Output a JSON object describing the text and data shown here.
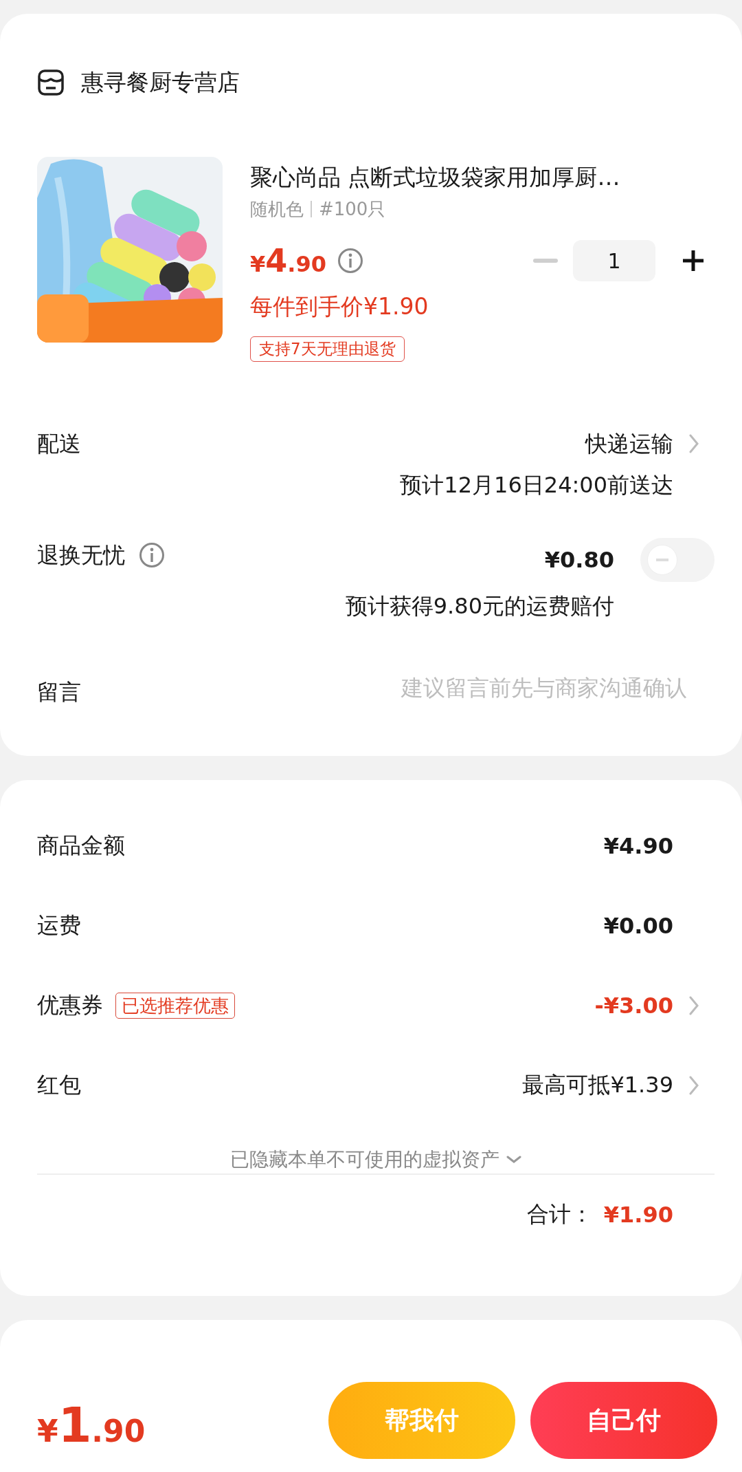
{
  "store": {
    "name": "惠寻餐厨专营店"
  },
  "product": {
    "title": "聚心尚品 点断式垃圾袋家用加厚厨…",
    "spec_color": "随机色",
    "spec_size": "#100只",
    "price_symbol": "¥",
    "price_int": "4",
    "price_dec": ".90",
    "final_price": "每件到手价¥1.90",
    "return_tag": "支持7天无理由退货",
    "quantity": "1",
    "decrease_disabled": true
  },
  "delivery": {
    "label": "配送",
    "method": "快递运输",
    "eta": "预计12月16日24:00前送达"
  },
  "return_insurance": {
    "label": "退换无忧",
    "price": "¥0.80",
    "on": false,
    "note": "预计获得9.80元的运费赔付"
  },
  "message": {
    "label": "留言",
    "placeholder": "建议留言前先与商家沟通确认"
  },
  "summary": {
    "rows": [
      {
        "label": "商品金额",
        "value": "¥4.90",
        "kind": "plain"
      },
      {
        "label": "运费",
        "value": "¥0.00",
        "kind": "plain"
      },
      {
        "label": "优惠券",
        "tag": "已选推荐优惠",
        "value": "-¥3.00",
        "kind": "discount"
      },
      {
        "label": "红包",
        "value": "最高可抵¥1.39",
        "kind": "link"
      }
    ],
    "hidden_note": "已隐藏本单不可使用的虚拟资产",
    "total_label": "合计：",
    "total": "¥1.90"
  },
  "bottom_bar": {
    "price_symbol": "¥",
    "price_int": "1",
    "price_dec": ".90",
    "buttons": [
      {
        "label": "帮我付",
        "kind": "secondary"
      },
      {
        "label": "自己付",
        "kind": "primary"
      }
    ]
  }
}
